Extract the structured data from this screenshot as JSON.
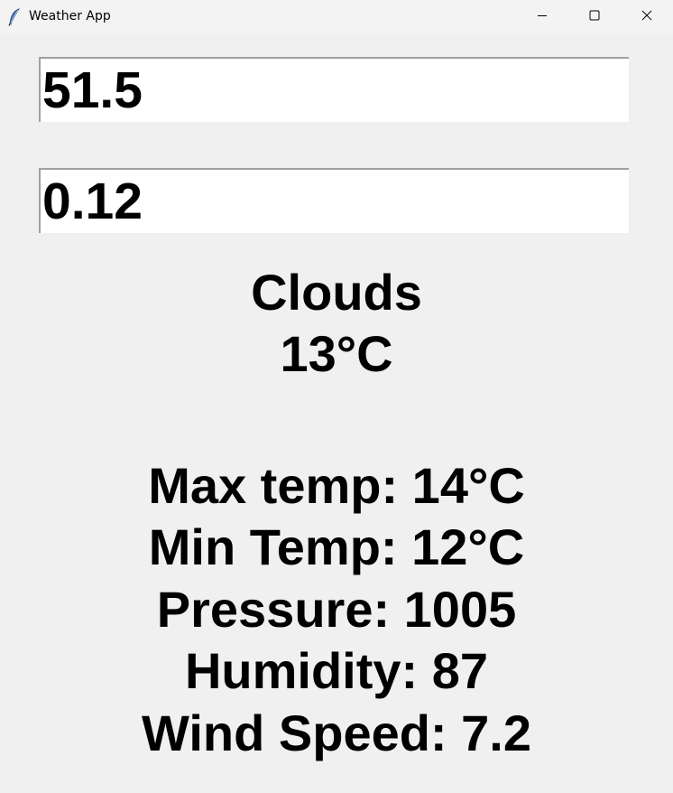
{
  "window": {
    "title": "Weather App",
    "icon": "feather-icon"
  },
  "controls": {
    "minimize_icon": "minimize-icon",
    "maximize_icon": "maximize-icon",
    "close_icon": "close-icon"
  },
  "inputs": {
    "first_value": "51.5",
    "second_value": "0.12"
  },
  "weather": {
    "condition": "Clouds",
    "temperature": "13°C"
  },
  "details": {
    "max_temp": "Max temp: 14°C",
    "min_temp": "Min Temp: 12°C",
    "pressure": "Pressure: 1005",
    "humidity": "Humidity: 87",
    "wind_speed": "Wind Speed: 7.2"
  }
}
